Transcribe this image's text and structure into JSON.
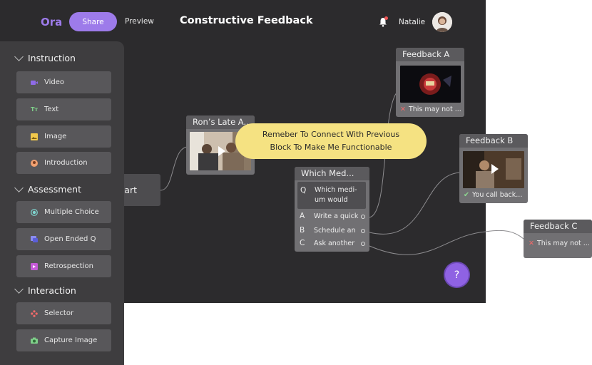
{
  "header": {
    "logo": "Ora",
    "share_label": "Share",
    "preview_label": "Preview",
    "title": "Constructive Feedback",
    "user_name": "Natalie"
  },
  "sidebar": {
    "sections": [
      {
        "label": "Instruction",
        "items": [
          {
            "label": "Video",
            "icon": "video-icon"
          },
          {
            "label": "Text",
            "icon": "text-icon"
          },
          {
            "label": "Image",
            "icon": "image-icon"
          },
          {
            "label": "Introduction",
            "icon": "introduction-icon"
          }
        ]
      },
      {
        "label": "Assessment",
        "items": [
          {
            "label": "Multiple Choice",
            "icon": "multiple-choice-icon"
          },
          {
            "label": "Open Ended Q",
            "icon": "chat-icon"
          },
          {
            "label": "Retrospection",
            "icon": "retrospection-icon"
          }
        ]
      },
      {
        "label": "Interaction",
        "items": [
          {
            "label": "Selector",
            "icon": "selector-icon"
          },
          {
            "label": "Capture Image",
            "icon": "camera-icon"
          }
        ]
      }
    ]
  },
  "canvas": {
    "start_node": "art",
    "video_node": {
      "title": "Ron’s Late A..."
    },
    "tooltip": {
      "line1": "Remeber To Connect With Previous",
      "line2": "Block To Make Me Functionable"
    },
    "question_node": {
      "title": "Which Med...",
      "question_letter": "Q",
      "question_line1": "Which medi-",
      "question_line2": "um would",
      "options": [
        {
          "letter": "A",
          "text": "Write a quick"
        },
        {
          "letter": "B",
          "text": "Schedule an"
        },
        {
          "letter": "C",
          "text": "Ask another"
        }
      ]
    },
    "feedback_a": {
      "title": "Feedback A",
      "caption": "This may not ..."
    },
    "feedback_b": {
      "title": "Feedback B",
      "caption": "You call back..."
    },
    "feedback_c": {
      "title": "Feedback C",
      "caption": "This may not ..."
    },
    "help_label": "?"
  },
  "colors": {
    "accent": "#9d7bea",
    "canvas": "#2c2b2d",
    "tooltip": "#f5e282"
  }
}
